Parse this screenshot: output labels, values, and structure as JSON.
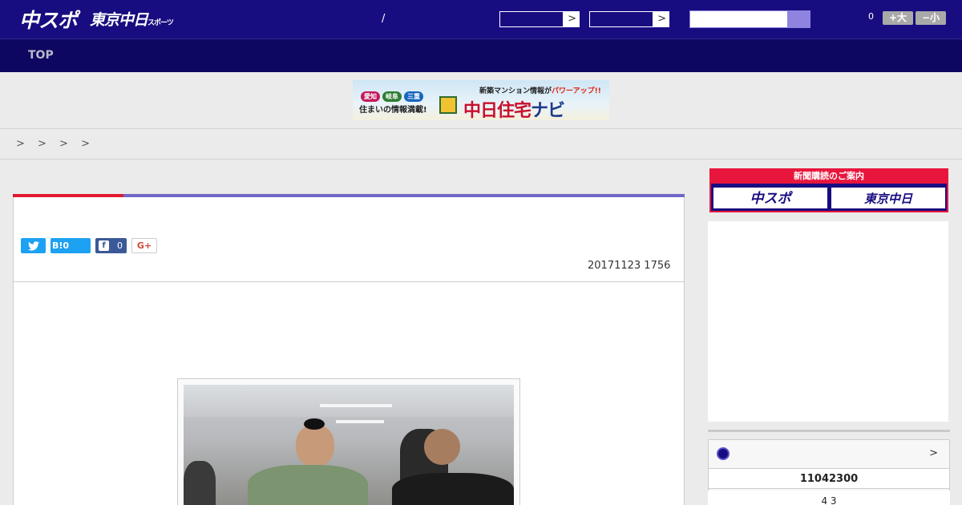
{
  "header": {
    "logo_primary": "中スポ",
    "logo_secondary": "東京中日",
    "logo_secondary_small": "スポーツ",
    "slash": "/",
    "select_arrow": ">",
    "article_count": "0",
    "font_larger_label": "+大",
    "font_smaller_label": "−小",
    "colors": {
      "header_bg": "#180d80",
      "nav_bg": "#0d0761",
      "accent_red": "#e1192f",
      "accent_purple": "#7067c6"
    }
  },
  "nav": {
    "top_label": "TOP"
  },
  "banner": {
    "pill_1": "愛知",
    "pill_2": "岐阜",
    "pill_3": "三重",
    "tagline": "住まいの情報満載!",
    "headline_prefix": "新築マンション情報が",
    "headline_emph": "パワーアップ!!",
    "brand_main": "中日住宅",
    "brand_sub": "ナビ"
  },
  "breadcrumb": {
    "text": "> > > >"
  },
  "article": {
    "share": {
      "twitter_icon": "twitter-icon",
      "hatena_label": "B!0",
      "facebook_icon_glyph": "f",
      "facebook_count": "0",
      "gplus_label": "G+"
    },
    "date": "20171123 1756"
  },
  "sidebar": {
    "subscription_header": "新聞購読のご案内",
    "sub_btn_chuspo": "中スポ",
    "sub_btn_tokyo": "東京中日",
    "widget_more": ">",
    "widget_row1": "11042300",
    "widget_row2": "4  3"
  }
}
